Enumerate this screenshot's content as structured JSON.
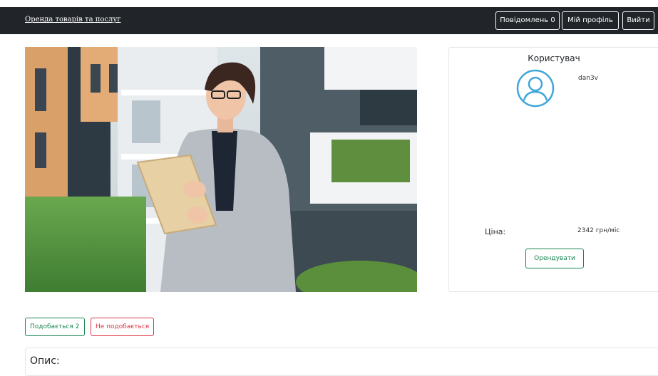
{
  "navbar": {
    "brand": "Оренда товарів та послуг",
    "notifications_label": "Повідомлень 0",
    "profile_label": "Мій профіль",
    "logout_label": "Вийти"
  },
  "listing": {
    "photo_icon": "listing-photo"
  },
  "user_card": {
    "title": "Користувач",
    "avatar_icon": "user-avatar-icon",
    "username": "dan3v",
    "price_label": "Ціна:",
    "price_value": "2342 грн/міс",
    "rent_label": "Орендувати"
  },
  "reactions": {
    "like_label": "Подобається 2",
    "dislike_label": "Не подобається"
  },
  "description": {
    "title": "Опис:"
  },
  "colors": {
    "navbar": "#212529",
    "success": "#198754",
    "danger": "#dc3545",
    "avatar": "#3fa6d8"
  }
}
